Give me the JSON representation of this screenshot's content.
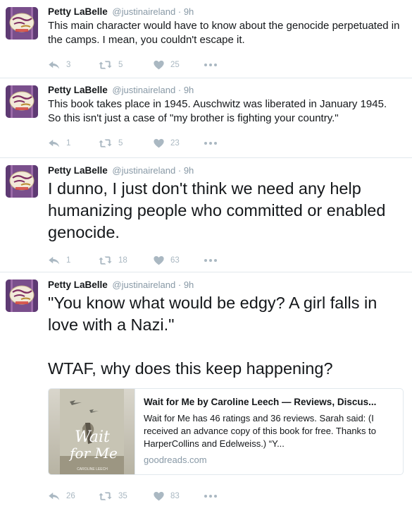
{
  "tweets": [
    {
      "name": "Petty LaBelle",
      "handle": "@justinaireland",
      "sep": "·",
      "time": "9h",
      "text": "This main character would have to know about the genocide perpetuated in the camps. I mean, you couldn't escape it.",
      "replies": "3",
      "retweets": "5",
      "likes": "25"
    },
    {
      "name": "Petty LaBelle",
      "handle": "@justinaireland",
      "sep": "·",
      "time": "9h",
      "text": "This book takes place in 1945. Auschwitz was liberated in January 1945. So this isn't just a case of \"my brother is fighting your country.\"",
      "replies": "1",
      "retweets": "5",
      "likes": "23"
    },
    {
      "name": "Petty LaBelle",
      "handle": "@justinaireland",
      "sep": "·",
      "time": "9h",
      "text": "I dunno, I just don't think we need any help humanizing people who committed or enabled genocide.",
      "replies": "1",
      "retweets": "18",
      "likes": "63"
    },
    {
      "name": "Petty LaBelle",
      "handle": "@justinaireland",
      "sep": "·",
      "time": "9h",
      "text": "\"You know what would be edgy? A girl falls in love with a Nazi.\"\n\nWTAF, why does this keep happening?",
      "replies": "26",
      "retweets": "35",
      "likes": "83",
      "card": {
        "title": "Wait for Me by Caroline Leech — Reviews, Discus...",
        "description": "Wait for Me has 46 ratings and 36 reviews. Sarah said: (I received an advance copy of this book for free. Thanks to HarperCollins and Edelweiss.) “Y...",
        "domain": "goodreads.com",
        "cover_title_1": "Wait",
        "cover_title_2": "for Me",
        "cover_author": "CAROLINE LEECH"
      }
    }
  ],
  "icons": {
    "avatar": "avatar-image",
    "reply": "reply-icon",
    "retweet": "retweet-icon",
    "like": "heart-icon",
    "more": "more-icon"
  },
  "colors": {
    "text": "#14171a",
    "secondary": "#8899a6",
    "action": "#aab8c2",
    "border": "#e1e8ed"
  }
}
